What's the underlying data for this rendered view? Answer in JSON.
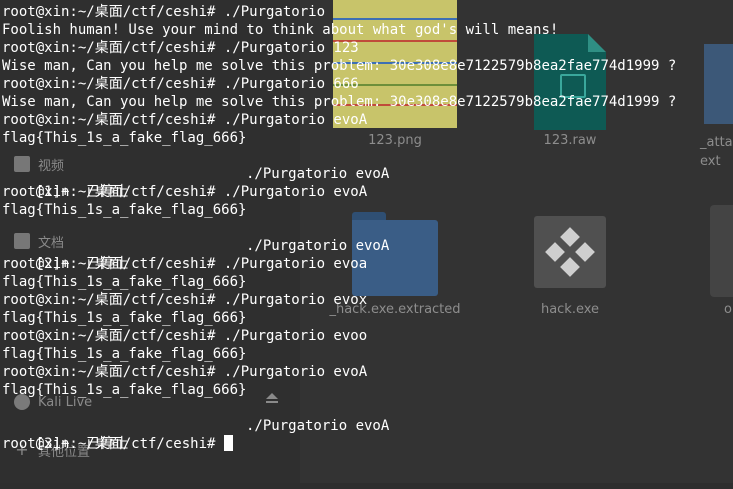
{
  "file_manager": {
    "sidebar": {
      "items": [
        {
          "label": "视频",
          "icon": "video-icon"
        },
        {
          "label": "文档",
          "icon": "documents-icon"
        },
        {
          "label": "Kali Live",
          "icon": "drive-icon"
        },
        {
          "label": "其他位置",
          "icon": "plus-icon"
        }
      ]
    },
    "files": [
      {
        "name": "123.png"
      },
      {
        "name": "123.raw"
      },
      {
        "name": "_atta\next"
      },
      {
        "name": "_hack.exe.extracted"
      },
      {
        "name": "hack.exe"
      },
      {
        "name": "o"
      }
    ]
  },
  "terminal": {
    "lines": [
      "root@xin:~/桌面/ctf/ceshi# ./Purgatorio",
      "Foolish human! Use your mind to think about what god's will means!",
      "root@xin:~/桌面/ctf/ceshi# ./Purgatorio 123",
      "Wise man, Can you help me solve this problem: 30e308e8e7122579b8ea2fae774d1999 ?",
      "root@xin:~/桌面/ctf/ceshi# ./Purgatorio 666",
      "Wise man, Can you help me solve this problem: 30e308e8e7122579b8ea2fae774d1999 ?",
      "root@xin:~/桌面/ctf/ceshi# ./Purgatorio evoA",
      "flag{This_1s_a_fake_flag_666}",
      "",
      "[1]+  已停止",
      "root@xin:~/桌面/ctf/ceshi# ./Purgatorio evoA",
      "flag{This_1s_a_fake_flag_666}",
      "",
      "[2]+  已停止",
      "root@xin:~/桌面/ctf/ceshi# ./Purgatorio evoa",
      "flag{This_1s_a_fake_flag_666}",
      "root@xin:~/桌面/ctf/ceshi# ./Purgatorio evox",
      "flag{This_1s_a_fake_flag_666}",
      "root@xin:~/桌面/ctf/ceshi# ./Purgatorio evoo",
      "flag{This_1s_a_fake_flag_666}",
      "root@xin:~/桌面/ctf/ceshi# ./Purgatorio evoA",
      "flag{This_1s_a_fake_flag_666}",
      "",
      "[3]+  已停止",
      "root@xin:~/桌面/ctf/ceshi# "
    ],
    "job_commands": [
      "./Purgatorio evoA",
      "./Purgatorio evoA",
      "./Purgatorio evoA"
    ]
  }
}
